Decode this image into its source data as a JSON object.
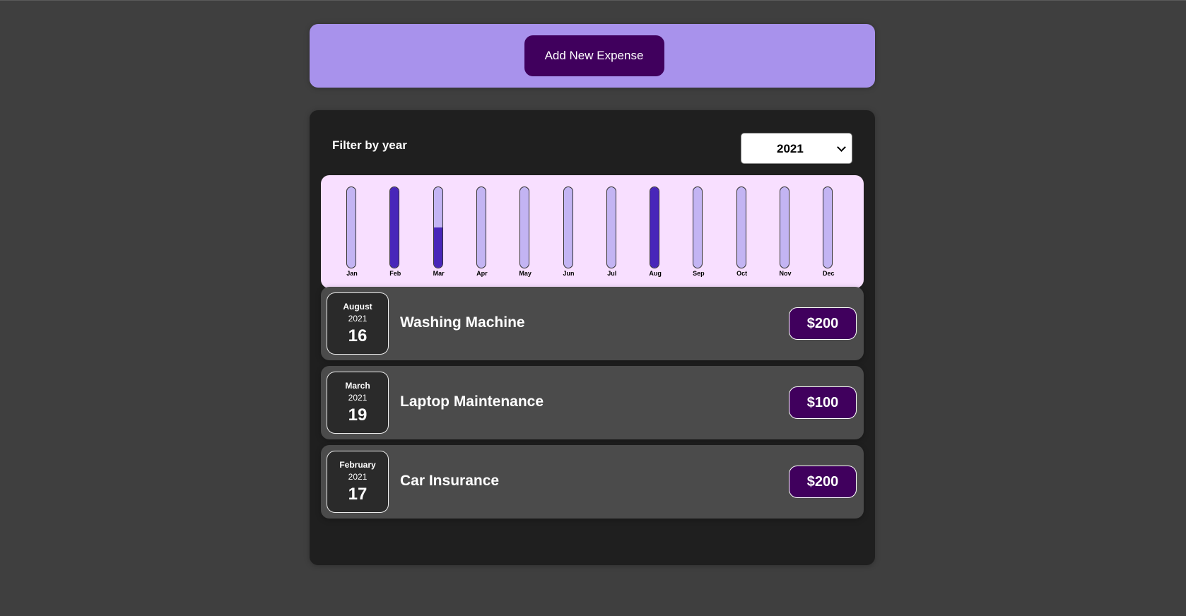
{
  "new_expense": {
    "add_label": "Add New Expense"
  },
  "filter": {
    "label": "Filter by year",
    "selected_year": "2021",
    "options": [
      "2021"
    ]
  },
  "chart_data": {
    "type": "bar",
    "categories": [
      "Jan",
      "Feb",
      "Mar",
      "Apr",
      "May",
      "Jun",
      "Jul",
      "Aug",
      "Sep",
      "Oct",
      "Nov",
      "Dec"
    ],
    "values": [
      0,
      200,
      100,
      0,
      0,
      0,
      0,
      200,
      0,
      0,
      0,
      0
    ],
    "ylim": [
      0,
      200
    ],
    "colors": {
      "track": "#c3b4f3",
      "fill": "#4826b9",
      "background": "#f8dfff"
    }
  },
  "expenses": [
    {
      "month": "August",
      "year": "2021",
      "day": "16",
      "title": "Washing Machine",
      "amount": "$200"
    },
    {
      "month": "March",
      "year": "2021",
      "day": "19",
      "title": "Laptop Maintenance",
      "amount": "$100"
    },
    {
      "month": "February",
      "year": "2021",
      "day": "17",
      "title": "Car Insurance",
      "amount": "$200"
    }
  ]
}
